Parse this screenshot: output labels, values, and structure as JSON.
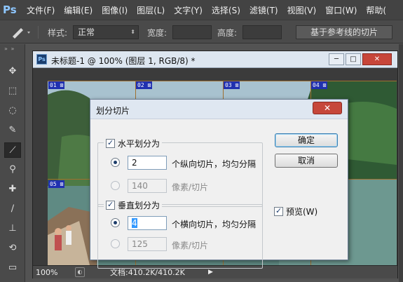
{
  "app": {
    "logo": "Ps"
  },
  "menu": [
    "文件(F)",
    "编辑(E)",
    "图像(I)",
    "图层(L)",
    "文字(Y)",
    "选择(S)",
    "滤镜(T)",
    "视图(V)",
    "窗口(W)",
    "帮助("
  ],
  "options_bar": {
    "style_label": "样式:",
    "style_value": "正常",
    "width_label": "宽度:",
    "height_label": "高度:",
    "guide_slice_button": "基于参考线的切片"
  },
  "document": {
    "title": "未标题-1 @ 100% (图层 1, RGB/8) *",
    "zoom": "100%",
    "doc_size": "文档:410.2K/410.2K",
    "slice_labels": [
      "01",
      "02",
      "03",
      "04",
      "05"
    ]
  },
  "dialog": {
    "title": "划分切片",
    "horizontal": {
      "checkbox_label": "水平划分为",
      "checked": true,
      "count_value": "2",
      "count_label": "个纵向切片，均匀分隔",
      "pixel_value": "140",
      "pixel_label": "像素/切片"
    },
    "vertical": {
      "checkbox_label": "垂直划分为",
      "checked": true,
      "count_value": "4",
      "count_label": "个横向切片，均匀分隔",
      "pixel_value": "125",
      "pixel_label": "像素/切片"
    },
    "ok_button": "确定",
    "cancel_button": "取消",
    "preview_label": "预览(W)",
    "preview_checked": true
  },
  "colors": {
    "slice_tag": "#2030b0",
    "dialog_close": "#c6473a"
  }
}
